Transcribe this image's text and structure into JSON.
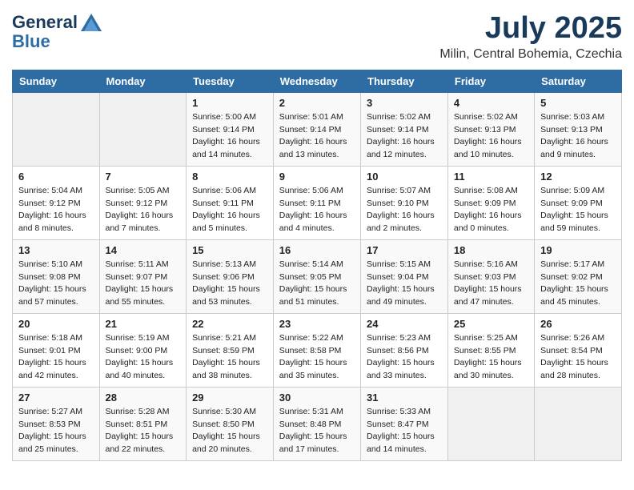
{
  "header": {
    "logo_line1": "General",
    "logo_line2": "Blue",
    "month": "July 2025",
    "location": "Milin, Central Bohemia, Czechia"
  },
  "days_of_week": [
    "Sunday",
    "Monday",
    "Tuesday",
    "Wednesday",
    "Thursday",
    "Friday",
    "Saturday"
  ],
  "weeks": [
    [
      {
        "day": "",
        "info": ""
      },
      {
        "day": "",
        "info": ""
      },
      {
        "day": "1",
        "info": "Sunrise: 5:00 AM\nSunset: 9:14 PM\nDaylight: 16 hours and 14 minutes."
      },
      {
        "day": "2",
        "info": "Sunrise: 5:01 AM\nSunset: 9:14 PM\nDaylight: 16 hours and 13 minutes."
      },
      {
        "day": "3",
        "info": "Sunrise: 5:02 AM\nSunset: 9:14 PM\nDaylight: 16 hours and 12 minutes."
      },
      {
        "day": "4",
        "info": "Sunrise: 5:02 AM\nSunset: 9:13 PM\nDaylight: 16 hours and 10 minutes."
      },
      {
        "day": "5",
        "info": "Sunrise: 5:03 AM\nSunset: 9:13 PM\nDaylight: 16 hours and 9 minutes."
      }
    ],
    [
      {
        "day": "6",
        "info": "Sunrise: 5:04 AM\nSunset: 9:12 PM\nDaylight: 16 hours and 8 minutes."
      },
      {
        "day": "7",
        "info": "Sunrise: 5:05 AM\nSunset: 9:12 PM\nDaylight: 16 hours and 7 minutes."
      },
      {
        "day": "8",
        "info": "Sunrise: 5:06 AM\nSunset: 9:11 PM\nDaylight: 16 hours and 5 minutes."
      },
      {
        "day": "9",
        "info": "Sunrise: 5:06 AM\nSunset: 9:11 PM\nDaylight: 16 hours and 4 minutes."
      },
      {
        "day": "10",
        "info": "Sunrise: 5:07 AM\nSunset: 9:10 PM\nDaylight: 16 hours and 2 minutes."
      },
      {
        "day": "11",
        "info": "Sunrise: 5:08 AM\nSunset: 9:09 PM\nDaylight: 16 hours and 0 minutes."
      },
      {
        "day": "12",
        "info": "Sunrise: 5:09 AM\nSunset: 9:09 PM\nDaylight: 15 hours and 59 minutes."
      }
    ],
    [
      {
        "day": "13",
        "info": "Sunrise: 5:10 AM\nSunset: 9:08 PM\nDaylight: 15 hours and 57 minutes."
      },
      {
        "day": "14",
        "info": "Sunrise: 5:11 AM\nSunset: 9:07 PM\nDaylight: 15 hours and 55 minutes."
      },
      {
        "day": "15",
        "info": "Sunrise: 5:13 AM\nSunset: 9:06 PM\nDaylight: 15 hours and 53 minutes."
      },
      {
        "day": "16",
        "info": "Sunrise: 5:14 AM\nSunset: 9:05 PM\nDaylight: 15 hours and 51 minutes."
      },
      {
        "day": "17",
        "info": "Sunrise: 5:15 AM\nSunset: 9:04 PM\nDaylight: 15 hours and 49 minutes."
      },
      {
        "day": "18",
        "info": "Sunrise: 5:16 AM\nSunset: 9:03 PM\nDaylight: 15 hours and 47 minutes."
      },
      {
        "day": "19",
        "info": "Sunrise: 5:17 AM\nSunset: 9:02 PM\nDaylight: 15 hours and 45 minutes."
      }
    ],
    [
      {
        "day": "20",
        "info": "Sunrise: 5:18 AM\nSunset: 9:01 PM\nDaylight: 15 hours and 42 minutes."
      },
      {
        "day": "21",
        "info": "Sunrise: 5:19 AM\nSunset: 9:00 PM\nDaylight: 15 hours and 40 minutes."
      },
      {
        "day": "22",
        "info": "Sunrise: 5:21 AM\nSunset: 8:59 PM\nDaylight: 15 hours and 38 minutes."
      },
      {
        "day": "23",
        "info": "Sunrise: 5:22 AM\nSunset: 8:58 PM\nDaylight: 15 hours and 35 minutes."
      },
      {
        "day": "24",
        "info": "Sunrise: 5:23 AM\nSunset: 8:56 PM\nDaylight: 15 hours and 33 minutes."
      },
      {
        "day": "25",
        "info": "Sunrise: 5:25 AM\nSunset: 8:55 PM\nDaylight: 15 hours and 30 minutes."
      },
      {
        "day": "26",
        "info": "Sunrise: 5:26 AM\nSunset: 8:54 PM\nDaylight: 15 hours and 28 minutes."
      }
    ],
    [
      {
        "day": "27",
        "info": "Sunrise: 5:27 AM\nSunset: 8:53 PM\nDaylight: 15 hours and 25 minutes."
      },
      {
        "day": "28",
        "info": "Sunrise: 5:28 AM\nSunset: 8:51 PM\nDaylight: 15 hours and 22 minutes."
      },
      {
        "day": "29",
        "info": "Sunrise: 5:30 AM\nSunset: 8:50 PM\nDaylight: 15 hours and 20 minutes."
      },
      {
        "day": "30",
        "info": "Sunrise: 5:31 AM\nSunset: 8:48 PM\nDaylight: 15 hours and 17 minutes."
      },
      {
        "day": "31",
        "info": "Sunrise: 5:33 AM\nSunset: 8:47 PM\nDaylight: 15 hours and 14 minutes."
      },
      {
        "day": "",
        "info": ""
      },
      {
        "day": "",
        "info": ""
      }
    ]
  ]
}
